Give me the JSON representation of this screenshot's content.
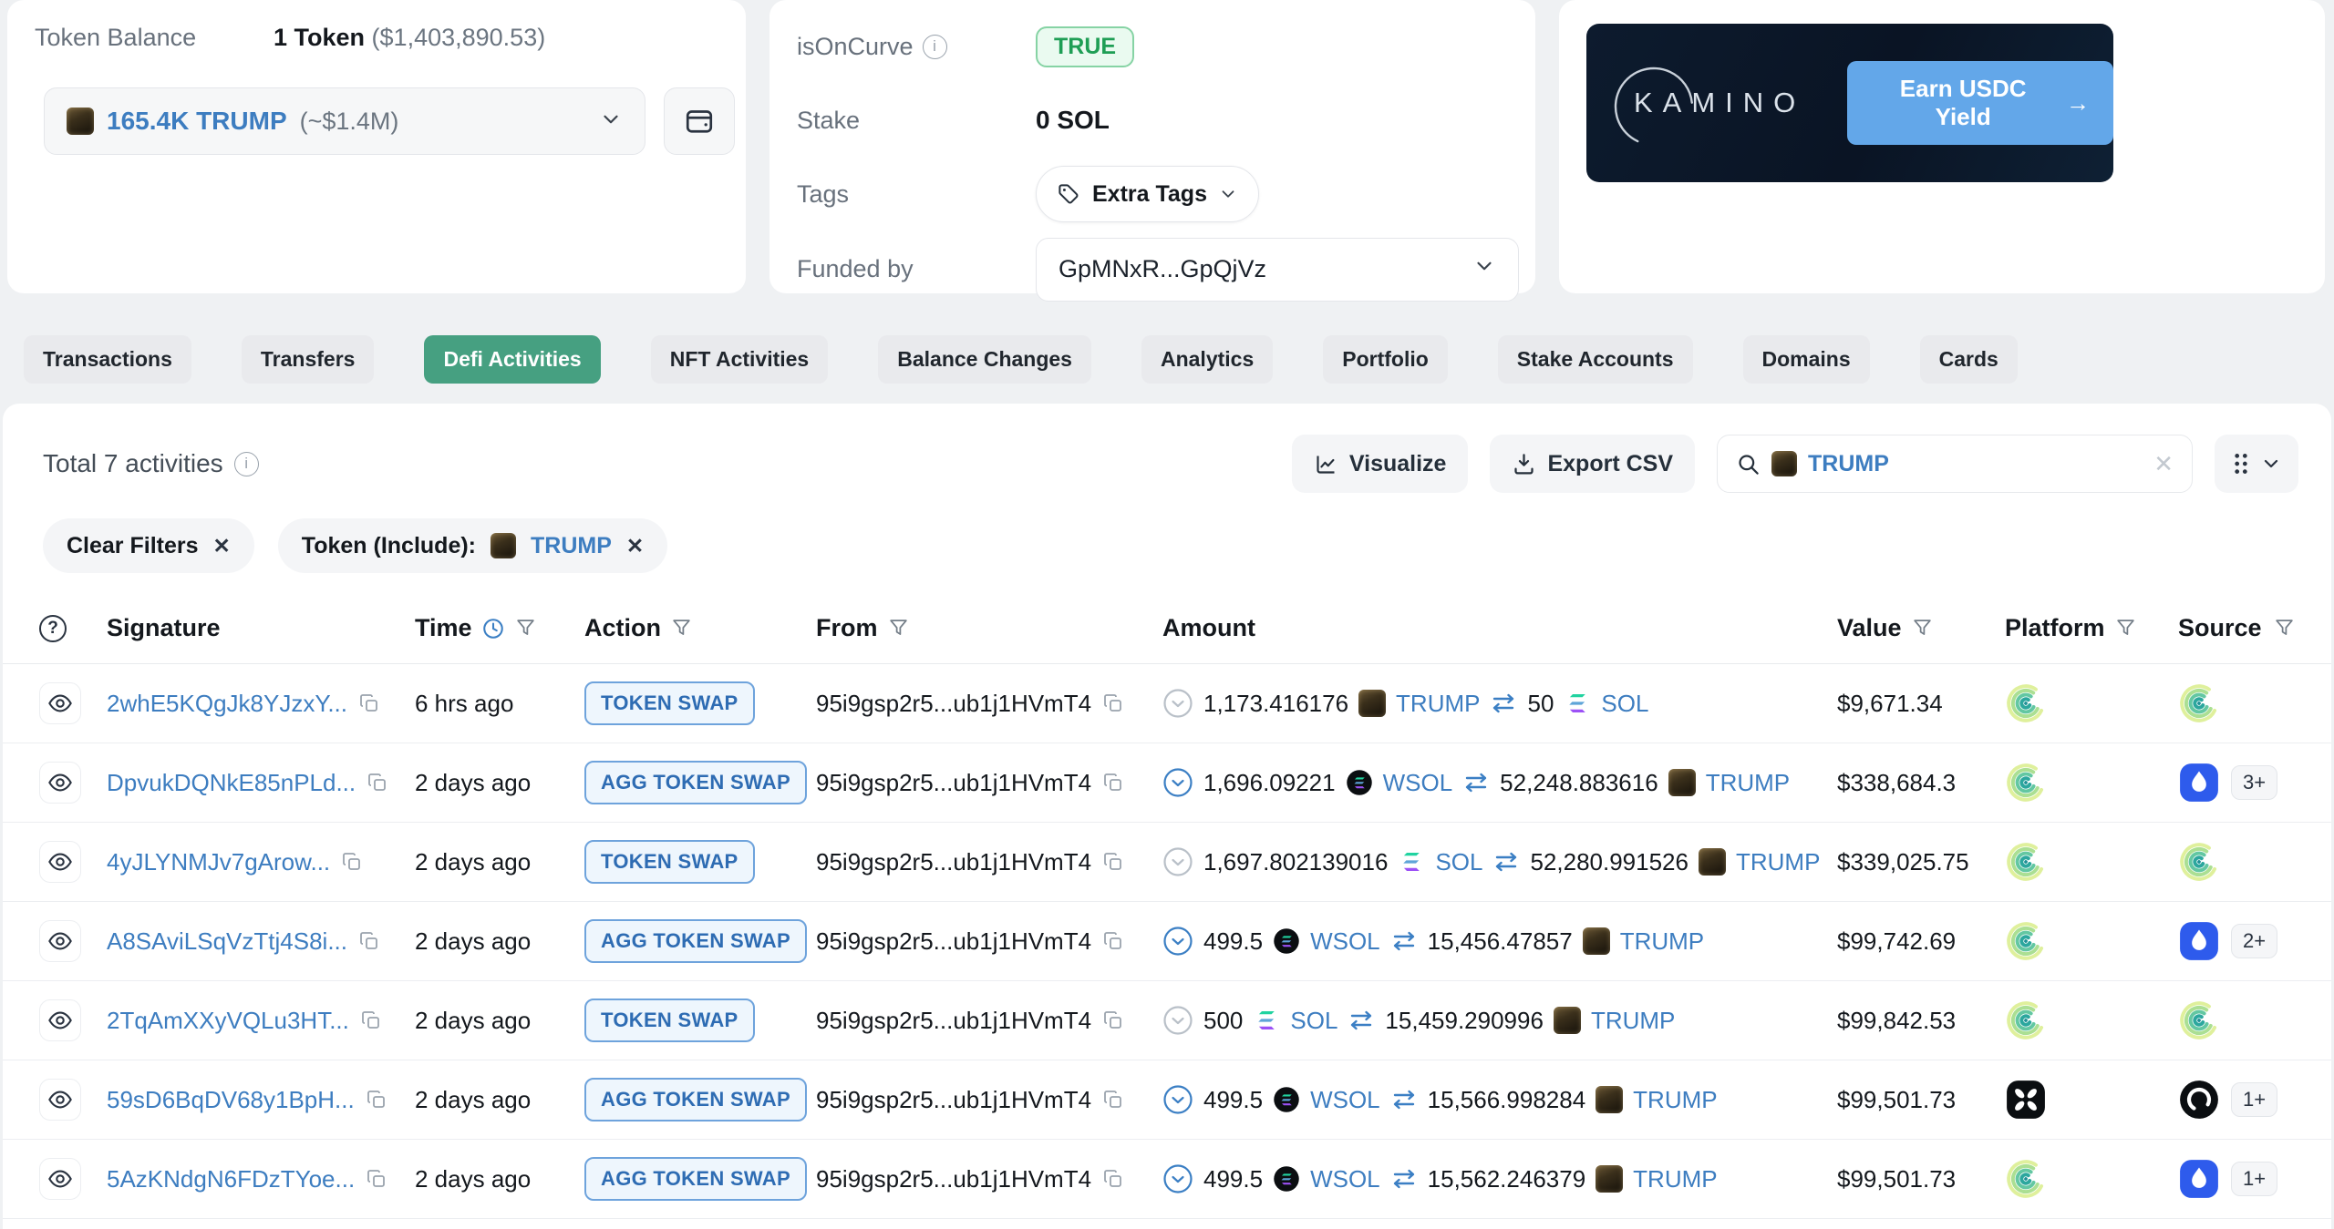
{
  "balance_card": {
    "label": "Token Balance",
    "value": "1 Token",
    "value_usd": "($1,403,890.53)",
    "token_amount": "165.4K TRUMP",
    "token_usd": "(~$1.4M)"
  },
  "details_card": {
    "is_on_curve_label": "isOnCurve",
    "is_on_curve_value": "TRUE",
    "stake_label": "Stake",
    "stake_value": "0 SOL",
    "tags_label": "Tags",
    "tags_button": "Extra Tags",
    "funded_label": "Funded by",
    "funded_value": "GpMNxR...GpQjVz"
  },
  "banner": {
    "brand": "KAMINO",
    "cta": "Earn USDC Yield",
    "cta_arrow": "→"
  },
  "tabs": [
    {
      "label": "Transactions",
      "active": false
    },
    {
      "label": "Transfers",
      "active": false
    },
    {
      "label": "Defi Activities",
      "active": true
    },
    {
      "label": "NFT Activities",
      "active": false
    },
    {
      "label": "Balance Changes",
      "active": false
    },
    {
      "label": "Analytics",
      "active": false
    },
    {
      "label": "Portfolio",
      "active": false
    },
    {
      "label": "Stake Accounts",
      "active": false
    },
    {
      "label": "Domains",
      "active": false
    },
    {
      "label": "Cards",
      "active": false
    }
  ],
  "toolbar": {
    "total_label": "Total 7 activities",
    "visualize": "Visualize",
    "export_csv": "Export CSV",
    "search_value": "TRUMP"
  },
  "filters": {
    "clear": "Clear Filters",
    "token_label": "Token (Include):",
    "token_value": "TRUMP"
  },
  "table": {
    "headers": [
      "Signature",
      "Time",
      "Action",
      "From",
      "Amount",
      "Value",
      "Platform",
      "Source"
    ],
    "rows": [
      {
        "signature": "2whE5KQgJk8YJzxY...",
        "time": "6 hrs ago",
        "action": "TOKEN SWAP",
        "from": "95i9gsp2r5...ub1j1HVmT4",
        "expand": "default",
        "amount_out": "1,173.416176",
        "token_out": "TRUMP",
        "token_out_icon": "trump",
        "amount_in": "50",
        "token_in": "SOL",
        "token_in_icon": "sol",
        "value": "$9,671.34",
        "platform_icon": "green-swirl",
        "source_icon": "green-swirl",
        "source_badge": ""
      },
      {
        "signature": "DpvukDQNkE85nPLd...",
        "time": "2 days ago",
        "action": "AGG TOKEN SWAP",
        "from": "95i9gsp2r5...ub1j1HVmT4",
        "expand": "active",
        "amount_out": "1,696.09221",
        "token_out": "WSOL",
        "token_out_icon": "wsol",
        "amount_in": "52,248.883616",
        "token_in": "TRUMP",
        "token_in_icon": "trump",
        "value": "$338,684.3",
        "platform_icon": "green-swirl",
        "source_icon": "blue-drop",
        "source_badge": "3+"
      },
      {
        "signature": "4yJLYNMJv7gArow...",
        "time": "2 days ago",
        "action": "TOKEN SWAP",
        "from": "95i9gsp2r5...ub1j1HVmT4",
        "expand": "default",
        "amount_out": "1,697.802139016",
        "token_out": "SOL",
        "token_out_icon": "sol",
        "amount_in": "52,280.991526",
        "token_in": "TRUMP",
        "token_in_icon": "trump",
        "value": "$339,025.75",
        "platform_icon": "green-swirl",
        "source_icon": "green-swirl",
        "source_badge": ""
      },
      {
        "signature": "A8SAviLSqVzTtj4S8i...",
        "time": "2 days ago",
        "action": "AGG TOKEN SWAP",
        "from": "95i9gsp2r5...ub1j1HVmT4",
        "expand": "active",
        "amount_out": "499.5",
        "token_out": "WSOL",
        "token_out_icon": "wsol",
        "amount_in": "15,456.47857",
        "token_in": "TRUMP",
        "token_in_icon": "trump",
        "value": "$99,742.69",
        "platform_icon": "green-swirl",
        "source_icon": "blue-drop",
        "source_badge": "2+"
      },
      {
        "signature": "2TqAmXXyVQLu3HT...",
        "time": "2 days ago",
        "action": "TOKEN SWAP",
        "from": "95i9gsp2r5...ub1j1HVmT4",
        "expand": "default",
        "amount_out": "500",
        "token_out": "SOL",
        "token_out_icon": "sol",
        "amount_in": "15,459.290996",
        "token_in": "TRUMP",
        "token_in_icon": "trump",
        "value": "$99,842.53",
        "platform_icon": "green-swirl",
        "source_icon": "green-swirl",
        "source_badge": ""
      },
      {
        "signature": "59sD6BqDV68y1BpH...",
        "time": "2 days ago",
        "action": "AGG TOKEN SWAP",
        "from": "95i9gsp2r5...ub1j1HVmT4",
        "expand": "active",
        "amount_out": "499.5",
        "token_out": "WSOL",
        "token_out_icon": "wsol",
        "amount_in": "15,566.998284",
        "token_in": "TRUMP",
        "token_in_icon": "trump",
        "value": "$99,501.73",
        "platform_icon": "black-petals",
        "source_icon": "black-ring",
        "source_badge": "1+"
      },
      {
        "signature": "5AzKNdgN6FDzTYoe...",
        "time": "2 days ago",
        "action": "AGG TOKEN SWAP",
        "from": "95i9gsp2r5...ub1j1HVmT4",
        "expand": "active",
        "amount_out": "499.5",
        "token_out": "WSOL",
        "token_out_icon": "wsol",
        "amount_in": "15,562.246379",
        "token_in": "TRUMP",
        "token_in_icon": "trump",
        "value": "$99,501.73",
        "platform_icon": "green-swirl",
        "source_icon": "blue-drop",
        "source_badge": "1+"
      }
    ]
  }
}
